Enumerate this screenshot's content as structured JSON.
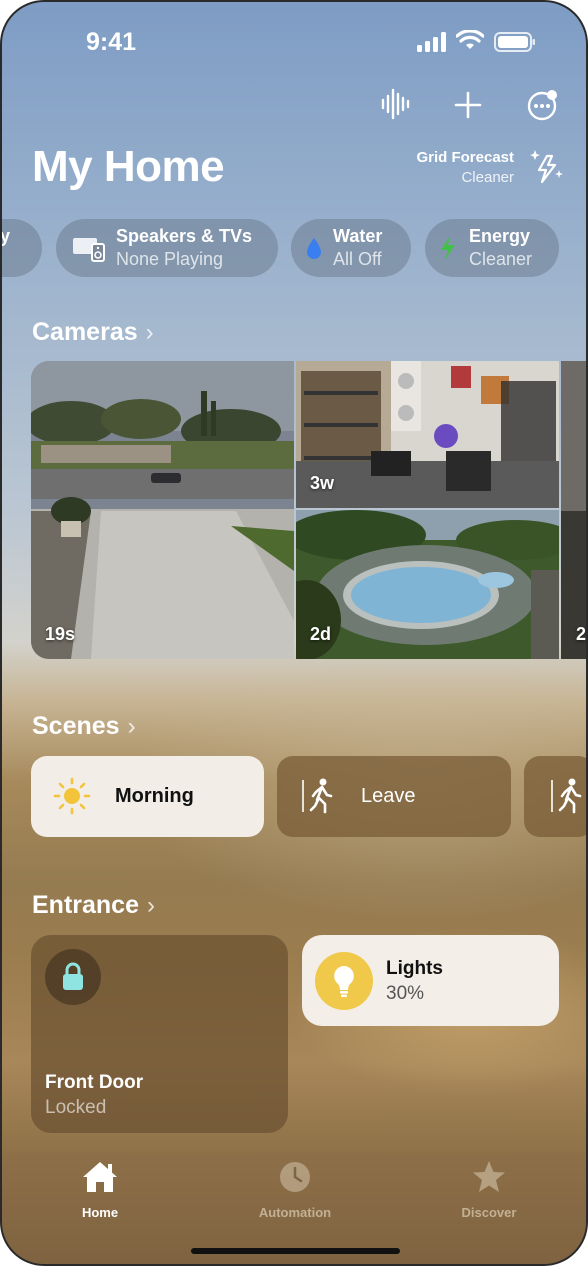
{
  "status": {
    "time": "9:41"
  },
  "header": {
    "title": "My Home",
    "grid_forecast": {
      "title": "Grid Forecast",
      "subtitle": "Cleaner"
    },
    "icons": [
      "waveform-icon",
      "plus-icon",
      "more-icon"
    ]
  },
  "chips": [
    {
      "label": "y",
      "icon": "partial-chip"
    },
    {
      "label": "Speakers & TVs",
      "subtitle": "None Playing",
      "icon": "speakers-tv-icon"
    },
    {
      "label": "Water",
      "subtitle": "All Off",
      "icon": "water-drop-icon"
    },
    {
      "label": "Energy",
      "subtitle": "Cleaner",
      "icon": "lightning-icon"
    }
  ],
  "cameras": {
    "heading": "Cameras",
    "feeds": [
      {
        "age": "19s",
        "scene": "driveway"
      },
      {
        "age": "3w",
        "scene": "garage-gym"
      },
      {
        "age": "2d",
        "scene": "backyard-pool"
      },
      {
        "age": "2",
        "scene": "partial"
      }
    ]
  },
  "scenes": {
    "heading": "Scenes",
    "items": [
      {
        "label": "Morning",
        "icon": "sun-icon",
        "active": true
      },
      {
        "label": "Leave",
        "icon": "walking-person-icon",
        "active": false
      }
    ]
  },
  "entrance": {
    "heading": "Entrance",
    "front_door": {
      "name": "Front Door",
      "state": "Locked",
      "icon": "lock-icon"
    },
    "lights": {
      "name": "Lights",
      "state": "30%",
      "icon": "lightbulb-icon"
    }
  },
  "tabbar": {
    "tabs": [
      {
        "label": "Home",
        "icon": "house-icon",
        "active": true
      },
      {
        "label": "Automation",
        "icon": "clock-icon",
        "active": false
      },
      {
        "label": "Discover",
        "icon": "star-icon",
        "active": false
      }
    ]
  },
  "colors": {
    "accent": "#f0c94a",
    "water": "#3a7ff0",
    "energy": "#43c04a",
    "lock": "#8fe3e0"
  }
}
